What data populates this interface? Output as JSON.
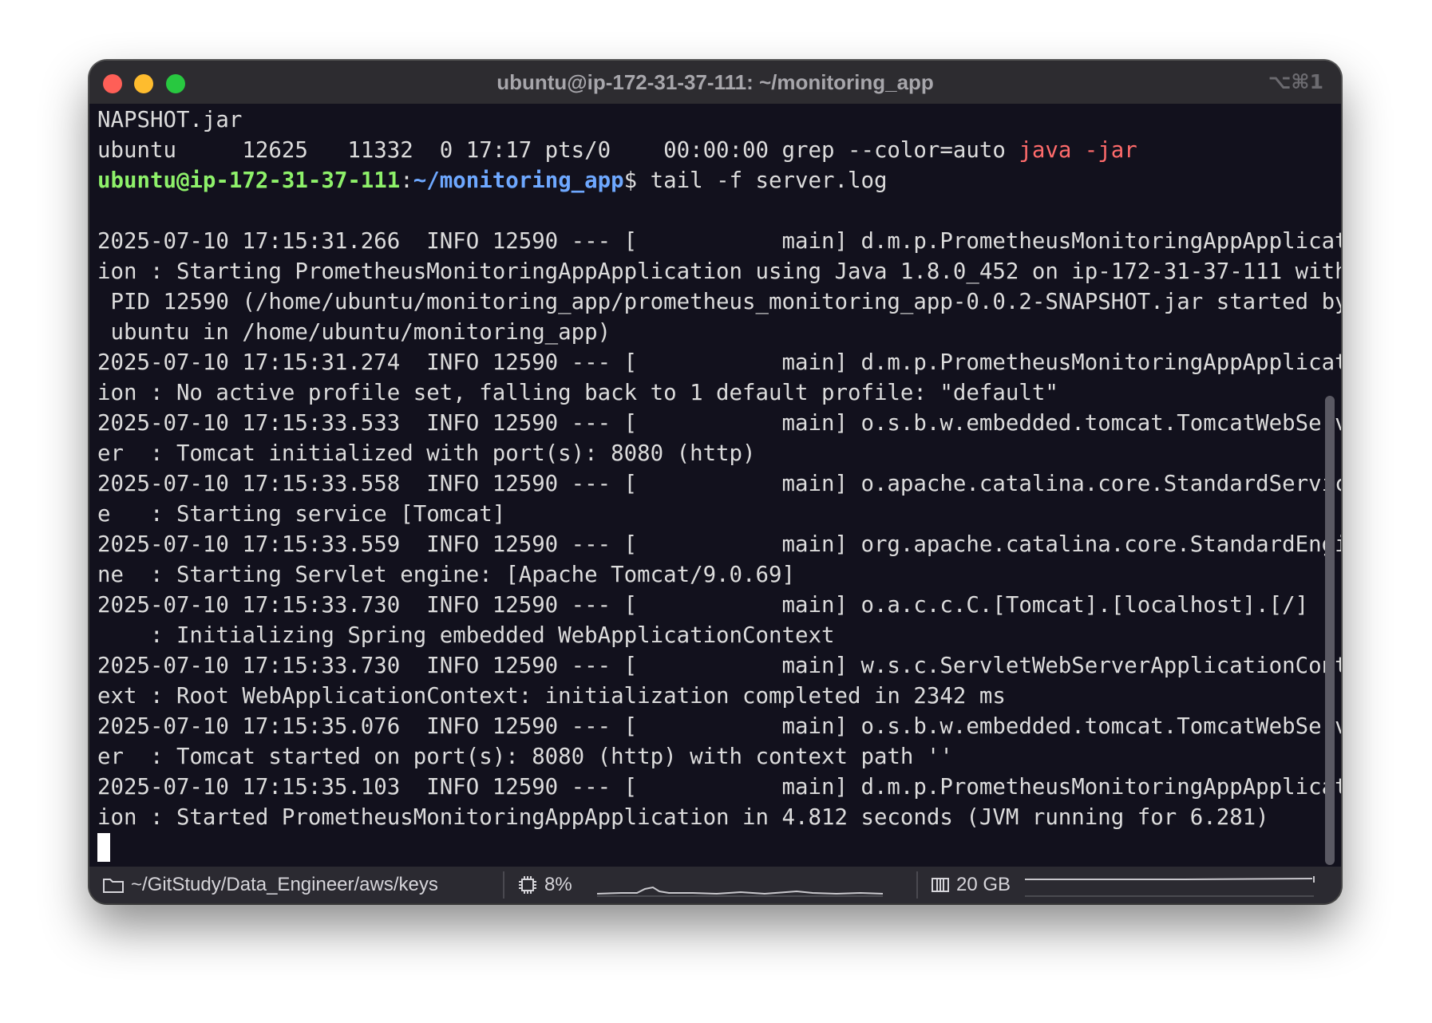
{
  "window": {
    "title": "ubuntu@ip-172-31-37-111: ~/monitoring_app",
    "shortcut": "⌥⌘1"
  },
  "terminal": {
    "line1": "NAPSHOT.jar",
    "line2_pre": "ubuntu     12625   11332  0 17:17 pts/0    00:00:00 grep --color=auto ",
    "line2_hl": "java -jar",
    "prompt_user": "ubuntu@ip-172-31-37-111",
    "prompt_sep": ":",
    "prompt_path": "~/monitoring_app",
    "prompt_cmd": "$ tail -f server.log",
    "log_lines": [
      "",
      "2025-07-10 17:15:31.266  INFO 12590 --- [           main] d.m.p.PrometheusMonitoringAppApplicat",
      "ion : Starting PrometheusMonitoringAppApplication using Java 1.8.0_452 on ip-172-31-37-111 with",
      " PID 12590 (/home/ubuntu/monitoring_app/prometheus_monitoring_app-0.0.2-SNAPSHOT.jar started by",
      " ubuntu in /home/ubuntu/monitoring_app)",
      "2025-07-10 17:15:31.274  INFO 12590 --- [           main] d.m.p.PrometheusMonitoringAppApplicat",
      "ion : No active profile set, falling back to 1 default profile: \"default\"",
      "2025-07-10 17:15:33.533  INFO 12590 --- [           main] o.s.b.w.embedded.tomcat.TomcatWebServ",
      "er  : Tomcat initialized with port(s): 8080 (http)",
      "2025-07-10 17:15:33.558  INFO 12590 --- [           main] o.apache.catalina.core.StandardServic",
      "e   : Starting service [Tomcat]",
      "2025-07-10 17:15:33.559  INFO 12590 --- [           main] org.apache.catalina.core.StandardEngi",
      "ne  : Starting Servlet engine: [Apache Tomcat/9.0.69]",
      "2025-07-10 17:15:33.730  INFO 12590 --- [           main] o.a.c.c.C.[Tomcat].[localhost].[/]",
      "    : Initializing Spring embedded WebApplicationContext",
      "2025-07-10 17:15:33.730  INFO 12590 --- [           main] w.s.c.ServletWebServerApplicationCont",
      "ext : Root WebApplicationContext: initialization completed in 2342 ms",
      "2025-07-10 17:15:35.076  INFO 12590 --- [           main] o.s.b.w.embedded.tomcat.TomcatWebServ",
      "er  : Tomcat started on port(s): 8080 (http) with context path ''",
      "2025-07-10 17:15:35.103  INFO 12590 --- [           main] d.m.p.PrometheusMonitoringAppApplicat",
      "ion : Started PrometheusMonitoringAppApplication in 4.812 seconds (JVM running for 6.281)"
    ]
  },
  "statusbar": {
    "folder_icon": "folder-icon",
    "path": "~/GitStudy/Data_Engineer/aws/keys",
    "cpu_icon": "cpu-icon",
    "cpu": "8%",
    "memory_icon": "memory-icon",
    "memory": "20 GB"
  },
  "colors": {
    "background": "#12111d",
    "titlebar": "#2d2c30",
    "prompt_user": "#8ef16a",
    "prompt_path": "#6ea8ff",
    "grep_highlight": "#ff6b6b",
    "close": "#fe5f57",
    "minimize": "#febc2e",
    "zoom": "#28c840"
  }
}
